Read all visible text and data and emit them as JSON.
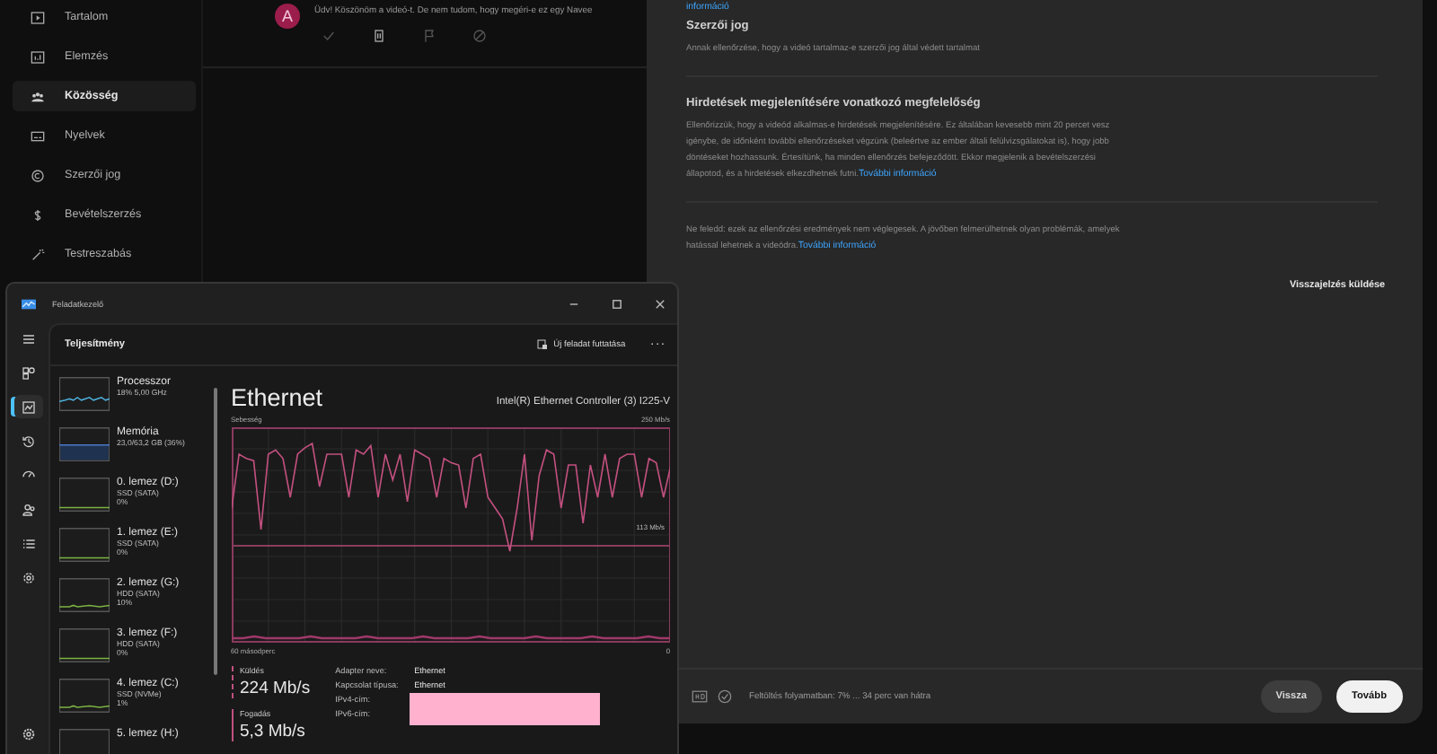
{
  "studio": {
    "sidebar": [
      {
        "label": "Tartalom",
        "kind": "content",
        "selected": false
      },
      {
        "label": "Elemzés",
        "kind": "analytics",
        "selected": false
      },
      {
        "label": "Közösség",
        "kind": "community",
        "selected": true
      },
      {
        "label": "Nyelvek",
        "kind": "subtitles",
        "selected": false
      },
      {
        "label": "Szerzői jog",
        "kind": "copyright",
        "selected": false
      },
      {
        "label": "Bevételszerzés",
        "kind": "money",
        "selected": false
      },
      {
        "label": "Testreszabás",
        "kind": "customize",
        "selected": false
      }
    ],
    "comment": {
      "avatar": "A",
      "text": "Üdv! Köszönöm a videó-t. De nem tudom, hogy megéri-e ez egy Navee"
    }
  },
  "dialog": {
    "top_link": "információ",
    "sections": [
      {
        "title": "Szerzői jog",
        "text": "Annak ellenőrzése, hogy a videó tartalmaz-e szerzői jog által védett tartalmat"
      },
      {
        "title": "Hirdetések megjelenítésére vonatkozó megfelelőség",
        "text": "Ellenőrizzük, hogy a videód alkalmas-e hirdetések megjelenítésére. Ez általában kevesebb mint 20 percet vesz igénybe, de időnként további ellenőrzéseket végzünk (beleértve az ember általi felülvizsgálatokat is), hogy jobb döntéseket hozhassunk. Értesítünk, ha minden ellenőrzés befejeződött. Ekkor megjelenik a bevételszerzési állapotod, és a hirdetések elkezdhetnek futni.",
        "link": "További információ"
      },
      {
        "text": "Ne feledd: ezek az ellenőrzési eredmények nem véglegesek. A jövőben felmerülhetnek olyan problémák, amelyek hatással lehetnek a videódra.",
        "link": "További információ"
      }
    ],
    "feedback": "Visszajelzés küldése",
    "status": "Feltöltés folyamatban: 7% ... 34 perc van hátra",
    "buttons": [
      {
        "label": "Vissza",
        "kind": "secondary"
      },
      {
        "label": "Tovább",
        "kind": "primary"
      }
    ]
  },
  "task_manager": {
    "title": "Feladatkezelő",
    "page_title": "Teljesítmény",
    "run_task": "Új feladat futtatása",
    "more": "...",
    "nav": [
      {
        "kind": "menu",
        "selected": false
      },
      {
        "kind": "processes",
        "selected": false
      },
      {
        "kind": "performance",
        "selected": true
      },
      {
        "kind": "history",
        "selected": false
      },
      {
        "kind": "startup",
        "selected": false
      },
      {
        "kind": "users",
        "selected": false
      },
      {
        "kind": "details",
        "selected": false
      },
      {
        "kind": "services",
        "selected": false
      },
      {
        "kind": "settings",
        "selected": false
      }
    ],
    "devices": [
      {
        "name": "Processzor",
        "detail": "18% 5,00 GHz",
        "kind": "cpu"
      },
      {
        "name": "Memória",
        "detail": "23,0/63,2 GB (36%)",
        "kind": "memory"
      },
      {
        "name": "0. lemez (D:)",
        "detail": "SSD (SATA)",
        "value": "0%",
        "kind": "disk"
      },
      {
        "name": "1. lemez (E:)",
        "detail": "SSD (SATA)",
        "value": "0%",
        "kind": "disk"
      },
      {
        "name": "2. lemez (G:)",
        "detail": "HDD (SATA)",
        "value": "10%",
        "kind": "disk"
      },
      {
        "name": "3. lemez (F:)",
        "detail": "HDD (SATA)",
        "value": "0%",
        "kind": "disk"
      },
      {
        "name": "4. lemez (C:)",
        "detail": "SSD (NVMe)",
        "value": "1%",
        "kind": "disk"
      },
      {
        "name": "5. lemez (H:)",
        "kind": "disk"
      }
    ],
    "detail": {
      "title": "Ethernet",
      "adapter": "Intel(R) Ethernet Controller (3) I225-V",
      "speed_label": "Sebesség",
      "max_label": "250 Mb/s",
      "mid_label": "113 Mb/s",
      "time_label": "60 másodperc",
      "zero_label": "0",
      "send": {
        "label": "Küldés",
        "value": "224 Mb/s"
      },
      "receive": {
        "label": "Fogadás",
        "value": "5,3 Mb/s"
      },
      "properties": [
        {
          "label": "Adapter neve:",
          "value": "Ethernet"
        },
        {
          "label": "Kapcsolat típusa:",
          "value": "Ethernet"
        },
        {
          "label": "IPv4-cím:"
        },
        {
          "label": "IPv6-cím:"
        }
      ]
    }
  }
}
